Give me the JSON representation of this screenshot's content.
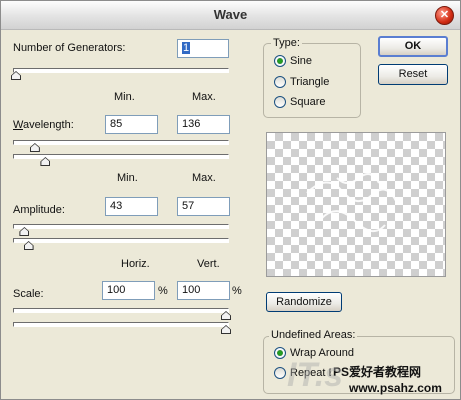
{
  "window": {
    "title": "Wave"
  },
  "generators": {
    "label": "Number of Generators:",
    "value": "1",
    "level": 0.0
  },
  "wavelength": {
    "label": "Wavelength:",
    "min_header": "Min.",
    "max_header": "Max.",
    "min": "85",
    "max": "136",
    "min_level": 0.09,
    "max_level": 0.14
  },
  "amplitude": {
    "label": "Amplitude:",
    "min_header": "Min.",
    "max_header": "Max.",
    "min": "43",
    "max": "57",
    "min_level": 0.04,
    "max_level": 0.06
  },
  "scale": {
    "label": "Scale:",
    "horiz_header": "Horiz.",
    "vert_header": "Vert.",
    "horiz": "100",
    "vert": "100",
    "unit": "%",
    "horiz_level": 1.0,
    "vert_level": 1.0
  },
  "type_group": {
    "legend": "Type:",
    "options": [
      {
        "label": "Sine",
        "selected": true
      },
      {
        "label": "Triangle",
        "selected": false
      },
      {
        "label": "Square",
        "selected": false
      }
    ]
  },
  "buttons": {
    "ok": "OK",
    "reset": "Reset",
    "randomize": "Randomize"
  },
  "undefined_group": {
    "legend": "Undefined Areas:",
    "options": [
      {
        "label": "Wrap Around",
        "selected": true
      },
      {
        "label": "Repeat Edge Pixels",
        "selected": false
      }
    ]
  },
  "watermark": {
    "prefix": "PS爱好者教程网",
    "url": "www.psahz.com",
    "logo": "IT.s"
  }
}
